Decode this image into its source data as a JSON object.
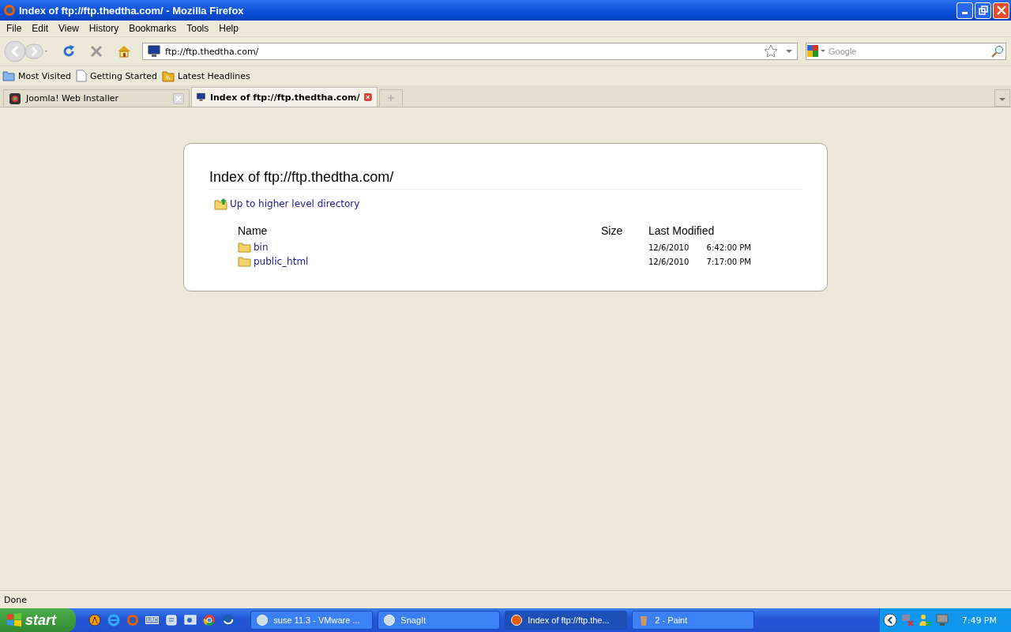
{
  "window": {
    "title": "Index of ftp://ftp.thedtha.com/ - Mozilla Firefox"
  },
  "menu": [
    "File",
    "Edit",
    "View",
    "History",
    "Bookmarks",
    "Tools",
    "Help"
  ],
  "address": {
    "value": "ftp://ftp.thedtha.com/"
  },
  "search": {
    "placeholder": "Google"
  },
  "bookmarks": [
    {
      "label": "Most Visited",
      "kind": "folder"
    },
    {
      "label": "Getting Started",
      "kind": "page"
    },
    {
      "label": "Latest Headlines",
      "kind": "feed"
    }
  ],
  "tabs": [
    {
      "label": "Joomla! Web Installer",
      "selected": false
    },
    {
      "label": "Index of ftp://ftp.thedtha.com/",
      "selected": true
    }
  ],
  "page": {
    "heading": "Index of ftp://ftp.thedtha.com/",
    "up_link": "Up to higher level directory",
    "columns": [
      "Name",
      "Size",
      "Last Modified"
    ],
    "rows": [
      {
        "name": "bin",
        "size": "",
        "date": "12/6/2010",
        "time": "6:42:00 PM"
      },
      {
        "name": "public_html",
        "size": "",
        "date": "12/6/2010",
        "time": "7:17:00 PM"
      }
    ]
  },
  "status_bar": "Done",
  "taskbar": {
    "start": "start",
    "quick_launch_label": "LRC",
    "buttons": [
      {
        "label": "suse 11.3 - VMware ...",
        "selected": false
      },
      {
        "label": "SnagIt",
        "selected": false
      },
      {
        "label": "Index of ftp://ftp.the...",
        "selected": true
      },
      {
        "label": "2 - Paint",
        "selected": false
      }
    ],
    "clock": "7:49 PM"
  }
}
